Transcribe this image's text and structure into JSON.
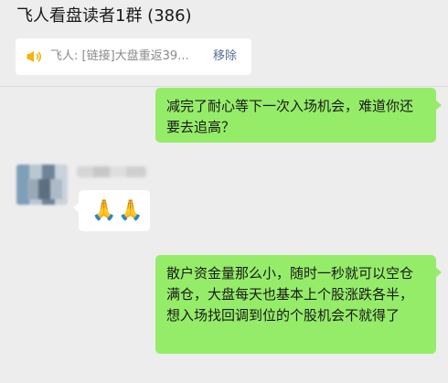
{
  "header": {
    "title": "飞人看盘读者1群 (386)"
  },
  "pinned": {
    "text": "飞人: [链接]大盘重返39...",
    "remove_label": "移除",
    "icon": "speaker-icon"
  },
  "messages": [
    {
      "side": "right",
      "text": "减完了耐心等下一次入场机会，难道你还要去追高？"
    },
    {
      "side": "left",
      "text": "🙏🙏"
    },
    {
      "side": "right",
      "text": "散户资金量那么小，随时一秒就可以空仓满仓，大盘每天也基本上个股涨跌各半，想入场找回调到位的个股机会不就得了"
    }
  ],
  "colors": {
    "self_bubble": "#95ec69",
    "other_bubble": "#ffffff",
    "link": "#576b95",
    "background": "#ededed"
  }
}
